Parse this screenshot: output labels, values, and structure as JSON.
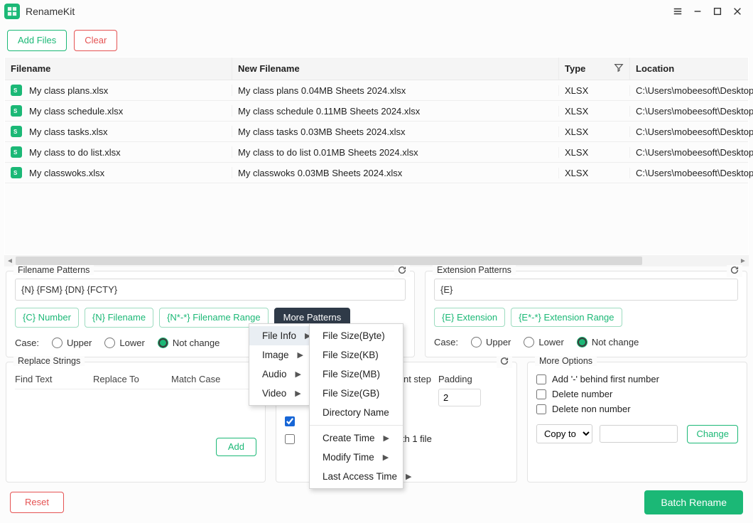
{
  "app": {
    "title": "RenameKit"
  },
  "buttons": {
    "add_files": "Add Files",
    "clear": "Clear",
    "add": "Add",
    "reset": "Reset",
    "batch_rename": "Batch Rename",
    "change": "Change",
    "more_patterns": "More Patterns"
  },
  "table": {
    "headers": {
      "filename": "Filename",
      "new_filename": "New Filename",
      "type": "Type",
      "location": "Location"
    },
    "rows": [
      {
        "fn": "My class plans.xlsx",
        "nfn": "My class plans 0.04MB Sheets 2024.xlsx",
        "type": "XLSX",
        "loc": "C:\\Users\\mobeesoft\\Desktop\\"
      },
      {
        "fn": "My class schedule.xlsx",
        "nfn": "My class schedule 0.11MB Sheets 2024.xlsx",
        "type": "XLSX",
        "loc": "C:\\Users\\mobeesoft\\Desktop\\"
      },
      {
        "fn": "My class tasks.xlsx",
        "nfn": "My class tasks 0.03MB Sheets 2024.xlsx",
        "type": "XLSX",
        "loc": "C:\\Users\\mobeesoft\\Desktop\\"
      },
      {
        "fn": "My class to do list.xlsx",
        "nfn": "My class to do list 0.01MB Sheets 2024.xlsx",
        "type": "XLSX",
        "loc": "C:\\Users\\mobeesoft\\Desktop\\"
      },
      {
        "fn": "My classwoks.xlsx",
        "nfn": "My classwoks 0.03MB Sheets 2024.xlsx",
        "type": "XLSX",
        "loc": "C:\\Users\\mobeesoft\\Desktop\\"
      }
    ]
  },
  "filename_patterns": {
    "title": "Filename Patterns",
    "value": "{N} {FSM} {DN} {FCTY}",
    "pills": {
      "number": "{C} Number",
      "filename": "{N} Filename",
      "range": "{N*-*} Filename Range"
    },
    "case_label": "Case:",
    "case": {
      "upper": "Upper",
      "lower": "Lower",
      "nochange": "Not change"
    }
  },
  "extension_patterns": {
    "title": "Extension Patterns",
    "value": "{E}",
    "pills": {
      "ext": "{E} Extension",
      "range": "{E*-*} Extension Range"
    },
    "case_label": "Case:",
    "case": {
      "upper": "Upper",
      "lower": "Lower",
      "nochange": "Not change"
    }
  },
  "replace": {
    "title": "Replace Strings",
    "cols": {
      "find": "Find Text",
      "replace": "Replace To",
      "match": "Match Case"
    }
  },
  "increment": {
    "cols": {
      "step_suffix": "nt step",
      "padding": "Padding"
    },
    "padding_value": "2",
    "opt2_suffix": "ith 1 file"
  },
  "more_options": {
    "title": "More Options",
    "opt1": "Add '-' behind first number",
    "opt2": "Delete number",
    "opt3": "Delete non number",
    "select_value": "Copy to"
  },
  "menu1": {
    "file_info": "File Info",
    "image": "Image",
    "audio": "Audio",
    "video": "Video"
  },
  "menu2": {
    "s_byte": "File Size(Byte)",
    "s_kb": "File Size(KB)",
    "s_mb": "File Size(MB)",
    "s_gb": "File Size(GB)",
    "dirname": "Directory Name",
    "create": "Create Time",
    "modify": "Modify Time",
    "access": "Last Access Time"
  }
}
